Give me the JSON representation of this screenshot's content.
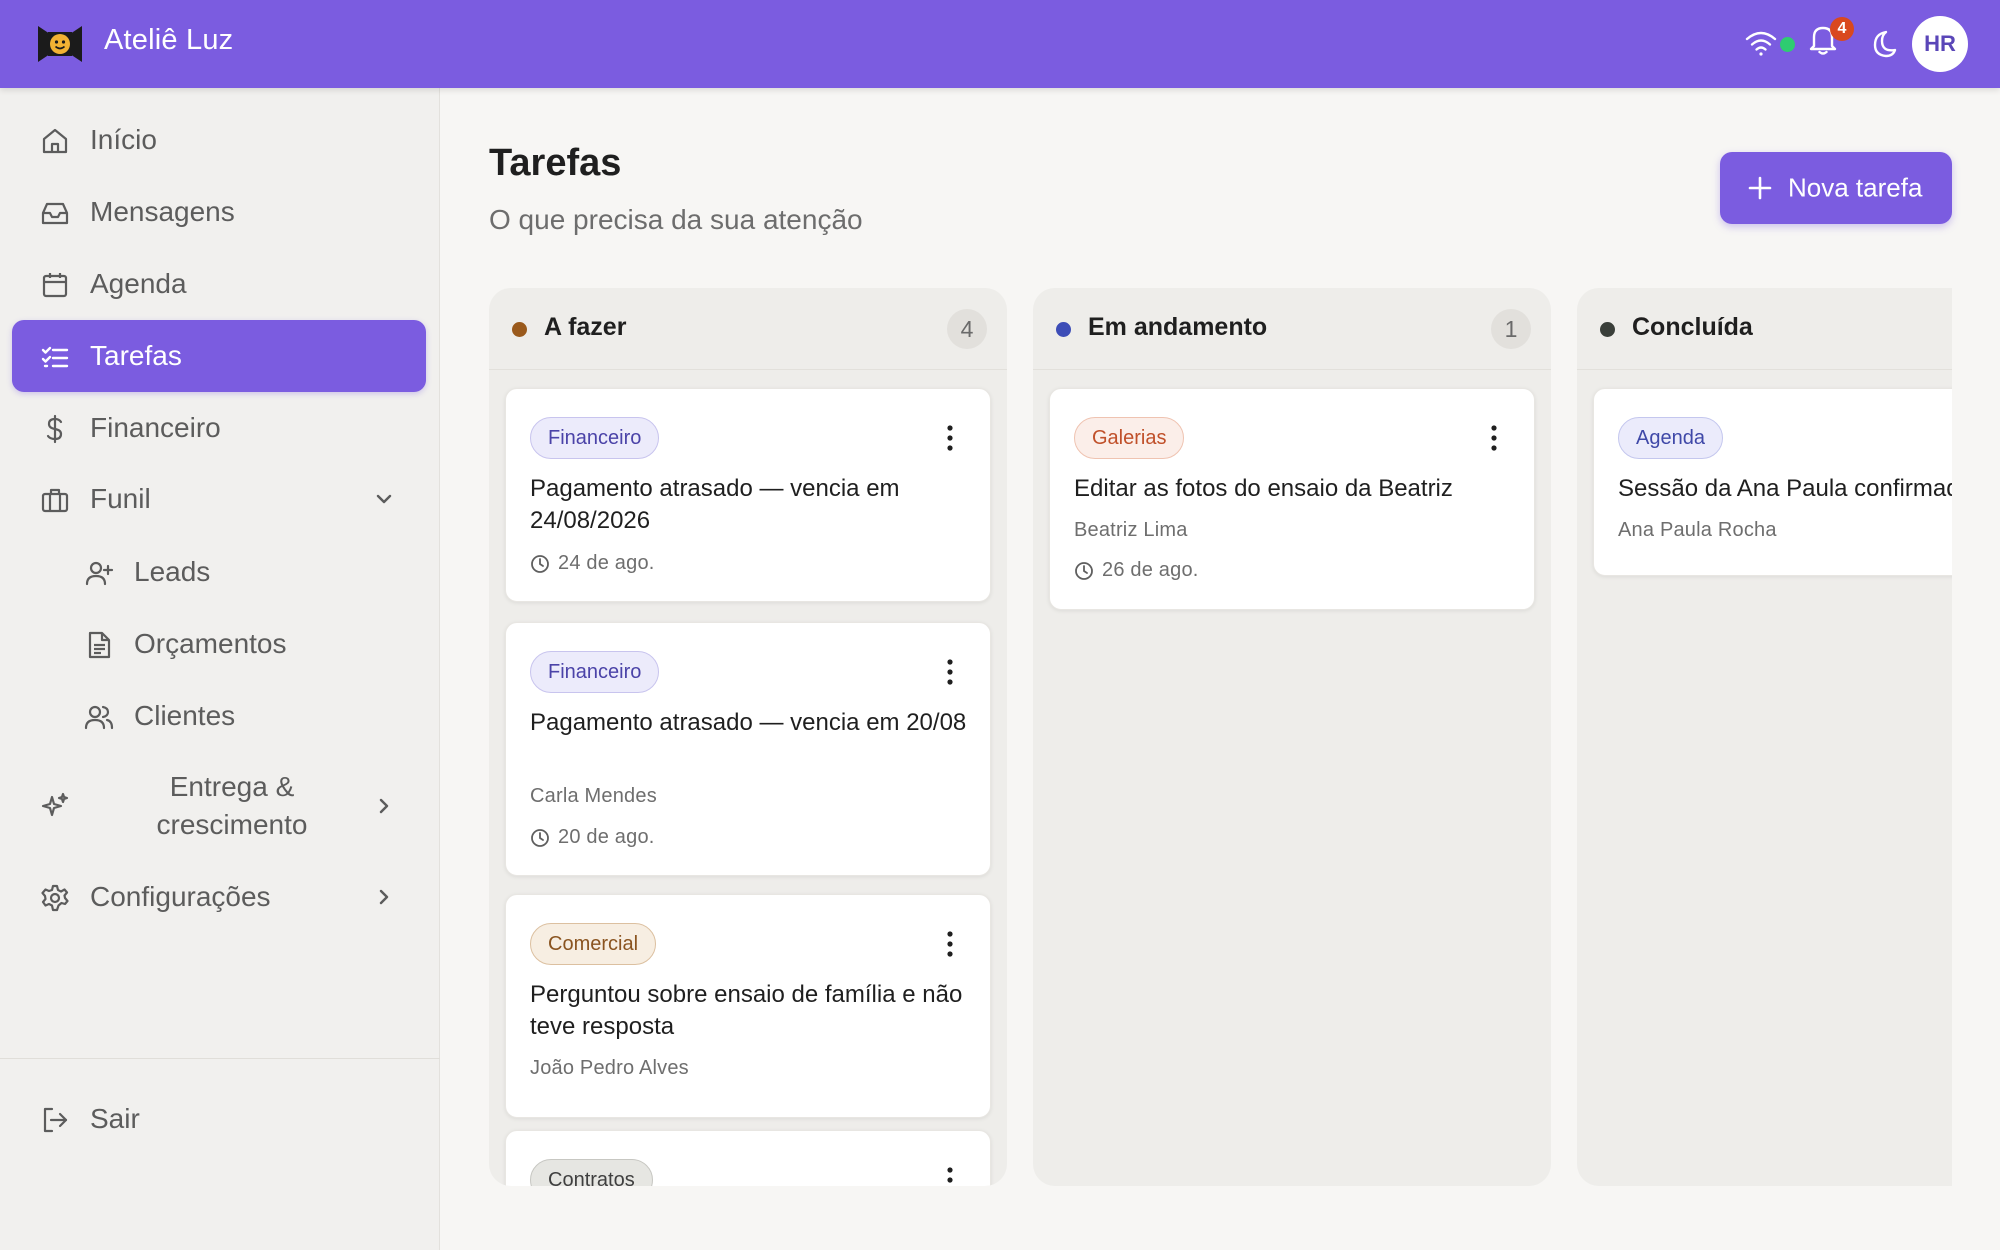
{
  "app": {
    "title": "Ateliê Luz",
    "user_initials": "HR",
    "notifications_count": "4"
  },
  "icons": {
    "logo": "camera-face-logo",
    "wifi": "wifi-icon",
    "bell": "bell-icon",
    "theme": "moon-icon"
  },
  "colors": {
    "accent": "#7b5ce0",
    "online": "#2ecc71",
    "badge": "#d9481f"
  },
  "sidebar": {
    "items": [
      {
        "label": "Início",
        "icon": "home-icon"
      },
      {
        "label": "Mensagens",
        "icon": "inbox-icon"
      },
      {
        "label": "Agenda",
        "icon": "calendar-icon"
      },
      {
        "label": "Tarefas",
        "icon": "checklist-icon",
        "active": true
      },
      {
        "label": "Financeiro",
        "icon": "dollar-icon"
      },
      {
        "label": "Funil",
        "icon": "briefcase-icon",
        "expanded": true
      }
    ],
    "funnel_children": [
      {
        "label": "Leads",
        "icon": "user-plus-icon"
      },
      {
        "label": "Orçamentos",
        "icon": "document-icon"
      },
      {
        "label": "Clientes",
        "icon": "users-icon"
      }
    ],
    "growth": {
      "label": "Entrega & crescimento",
      "icon": "sparkles-icon"
    },
    "settings": {
      "label": "Configurações",
      "icon": "gear-icon"
    },
    "logout": {
      "label": "Sair",
      "icon": "logout-icon"
    }
  },
  "main": {
    "title": "Tarefas",
    "subtitle": "O que precisa da sua atenção",
    "new_task_label": "Nova tarefa"
  },
  "columns": [
    {
      "title": "A fazer",
      "count": "4",
      "dot_color": "#9a5a1c",
      "cards": [
        {
          "tag": "Financeiro",
          "title": "Pagamento atrasado — vencia em 24/08/2026",
          "client": "",
          "date": "24 de ago."
        },
        {
          "tag": "Financeiro",
          "title": "Pagamento atrasado — vencia em 20/08",
          "client": "Carla Mendes",
          "date": "20 de ago."
        },
        {
          "tag": "Comercial",
          "title": "Perguntou sobre ensaio de família e não teve resposta",
          "client": "João Pedro Alves",
          "date": ""
        },
        {
          "tag": "Contratos",
          "title": "",
          "client": "",
          "date": ""
        }
      ]
    },
    {
      "title": "Em andamento",
      "count": "1",
      "dot_color": "#3d4db7",
      "cards": [
        {
          "tag": "Galerias",
          "title": "Editar as fotos do ensaio da Beatriz",
          "client": "Beatriz Lima",
          "date": "26 de ago."
        }
      ]
    },
    {
      "title": "Concluída",
      "count": "",
      "dot_color": "#3a3f3a",
      "cards": [
        {
          "tag": "Agenda",
          "title": "Sessão da Ana Paula confirmada",
          "client": "Ana Paula Rocha",
          "date": ""
        }
      ]
    }
  ]
}
